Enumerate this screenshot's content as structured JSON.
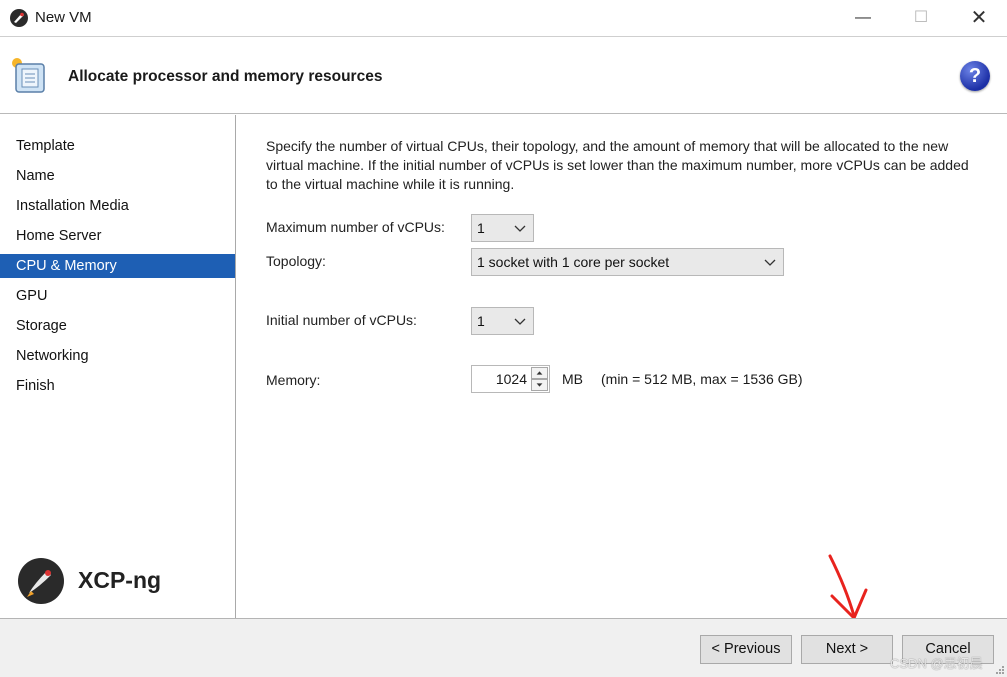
{
  "window": {
    "title": "New VM",
    "controls": {
      "minimize": "—",
      "maximize": "☐",
      "close": "✕"
    }
  },
  "header": {
    "title": "Allocate processor and memory resources",
    "help_symbol": "?"
  },
  "sidebar": {
    "items": [
      {
        "label": "Template",
        "active": false
      },
      {
        "label": "Name",
        "active": false
      },
      {
        "label": "Installation Media",
        "active": false
      },
      {
        "label": "Home Server",
        "active": false
      },
      {
        "label": "CPU & Memory",
        "active": true
      },
      {
        "label": "GPU",
        "active": false
      },
      {
        "label": "Storage",
        "active": false
      },
      {
        "label": "Networking",
        "active": false
      },
      {
        "label": "Finish",
        "active": false
      }
    ],
    "brand": "XCP-ng"
  },
  "main": {
    "description": "Specify the number of virtual CPUs, their topology, and the amount of memory that will be allocated to the new virtual machine. If the initial number of vCPUs is set lower than the maximum number, more vCPUs can be added to the virtual machine while it is running.",
    "max_vcpus": {
      "label": "Maximum number of vCPUs:",
      "value": "1"
    },
    "topology": {
      "label": "Topology:",
      "value": "1 socket with 1 core per socket"
    },
    "initial_vcpus": {
      "label": "Initial number of vCPUs:",
      "value": "1"
    },
    "memory": {
      "label": "Memory:",
      "value": "1024",
      "unit": "MB",
      "range": "(min = 512 MB, max = 1536 GB)"
    }
  },
  "footer": {
    "previous": "< Previous",
    "next": "Next >",
    "cancel": "Cancel",
    "watermark": "CSDN @思初晨"
  },
  "colors": {
    "selection": "#1e5fb4",
    "annotation_arrow": "#e8231e"
  }
}
